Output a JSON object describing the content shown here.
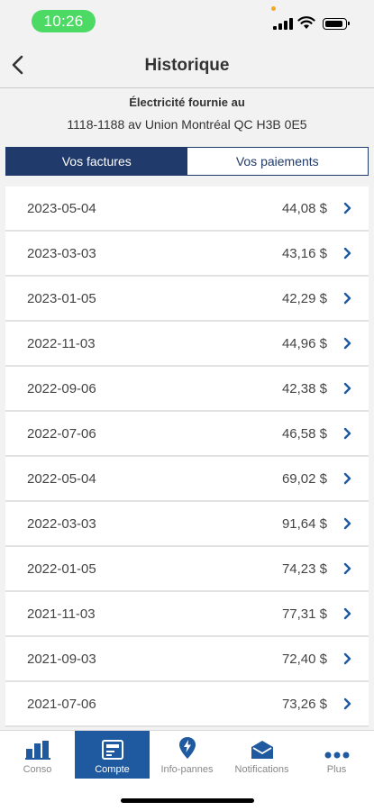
{
  "status_bar": {
    "time": "10:26"
  },
  "nav": {
    "title": "Historique",
    "back_icon": "chevron-left-icon"
  },
  "address": {
    "label": "Électricité fournie au",
    "value": "1118-1188 av Union Montréal QC H3B 0E5"
  },
  "tabs": [
    {
      "label": "Vos factures",
      "active": true
    },
    {
      "label": "Vos paiements",
      "active": false
    }
  ],
  "invoices": [
    {
      "date": "2023-05-04",
      "amount": "44,08 $"
    },
    {
      "date": "2023-03-03",
      "amount": "43,16 $"
    },
    {
      "date": "2023-01-05",
      "amount": "42,29 $"
    },
    {
      "date": "2022-11-03",
      "amount": "44,96 $"
    },
    {
      "date": "2022-09-06",
      "amount": "42,38 $"
    },
    {
      "date": "2022-07-06",
      "amount": "46,58 $"
    },
    {
      "date": "2022-05-04",
      "amount": "69,02 $"
    },
    {
      "date": "2022-03-03",
      "amount": "91,64 $"
    },
    {
      "date": "2022-01-05",
      "amount": "74,23 $"
    },
    {
      "date": "2021-11-03",
      "amount": "77,31 $"
    },
    {
      "date": "2021-09-03",
      "amount": "72,40 $"
    },
    {
      "date": "2021-07-06",
      "amount": "73,26 $"
    }
  ],
  "tabbar": [
    {
      "label": "Conso",
      "icon": "bar-chart-icon",
      "active": false
    },
    {
      "label": "Compte",
      "icon": "bill-icon",
      "active": true
    },
    {
      "label": "Info-pannes",
      "icon": "outage-pin-icon",
      "active": false
    },
    {
      "label": "Notifications",
      "icon": "envelope-icon",
      "active": false
    },
    {
      "label": "Plus",
      "icon": "more-dots-icon",
      "active": false
    }
  ],
  "colors": {
    "primary": "#1f3a6b",
    "active_tab": "#1f5aa0",
    "time_pill": "#4cd964",
    "chevron": "#1f5aa0"
  }
}
